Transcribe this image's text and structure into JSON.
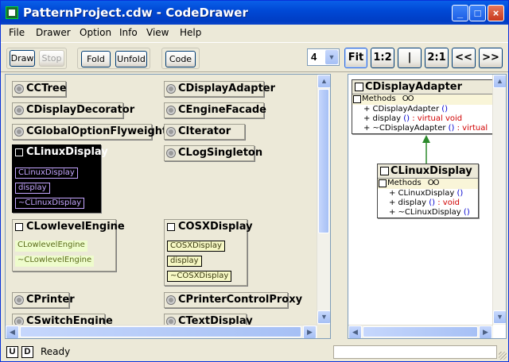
{
  "window": {
    "title": "PatternProject.cdw - CodeDrawer",
    "minimize": "_",
    "maximize": "□",
    "close": "×"
  },
  "menu": [
    "File",
    "Drawer",
    "Option",
    "Info",
    "View",
    "Help"
  ],
  "toolbar": {
    "draw": "Draw",
    "stop": "Stop",
    "fold": "Fold",
    "unfold": "Unfold",
    "code": "Code",
    "depth_value": "4",
    "fit": "Fit",
    "ratio_1_2": "1:2",
    "ratio_1": "|",
    "ratio_2_1": "2:1",
    "prev": "<<",
    "next": ">>"
  },
  "class_list": {
    "collapsed": [
      {
        "name": "CCTree"
      },
      {
        "name": "CDisplayAdapter"
      },
      {
        "name": "CDisplayDecorator"
      },
      {
        "name": "CEngineFacade"
      },
      {
        "name": "CGlobalOptionFlyweight"
      },
      {
        "name": "CIterator"
      },
      {
        "name": "CLogSingleton"
      },
      {
        "name": "CPrinter"
      },
      {
        "name": "CPrinterControlProxy"
      },
      {
        "name": "CSwitchEngine"
      },
      {
        "name": "CTextDisplay"
      }
    ],
    "expanded": [
      {
        "name": "CLinuxDisplay",
        "methods": [
          "CLinuxDisplay",
          "display",
          "~CLinuxDisplay"
        ]
      },
      {
        "name": "CLowlevelEngine",
        "methods": [
          "CLowlevelEngine",
          "~CLowlevelEngine"
        ]
      },
      {
        "name": "COSXDisplay",
        "methods": [
          "COSXDisplay",
          "display",
          "~COSXDisplay"
        ]
      }
    ]
  },
  "diagram": {
    "parent": {
      "name": "CDisplayAdapter",
      "section": "Methods",
      "rows": [
        {
          "sig": "+ CDisplayAdapter",
          "parens": "()",
          "extra": ""
        },
        {
          "sig": "+ display",
          "parens": "()",
          "extra": " : virtual void"
        },
        {
          "sig": "+ ~CDisplayAdapter",
          "parens": "()",
          "extra": " : virtual"
        }
      ]
    },
    "child": {
      "name": "CLinuxDisplay",
      "section": "Methods",
      "rows": [
        {
          "sig": "+ CLinuxDisplay",
          "parens": "()",
          "extra": ""
        },
        {
          "sig": "+ display",
          "parens": "()",
          "extra": " : void"
        },
        {
          "sig": "+ ~CLinuxDisplay",
          "parens": "()",
          "extra": ""
        }
      ]
    },
    "section_icons": "OO"
  },
  "status": {
    "u_button": "U",
    "d_button": "D",
    "text": "Ready"
  }
}
